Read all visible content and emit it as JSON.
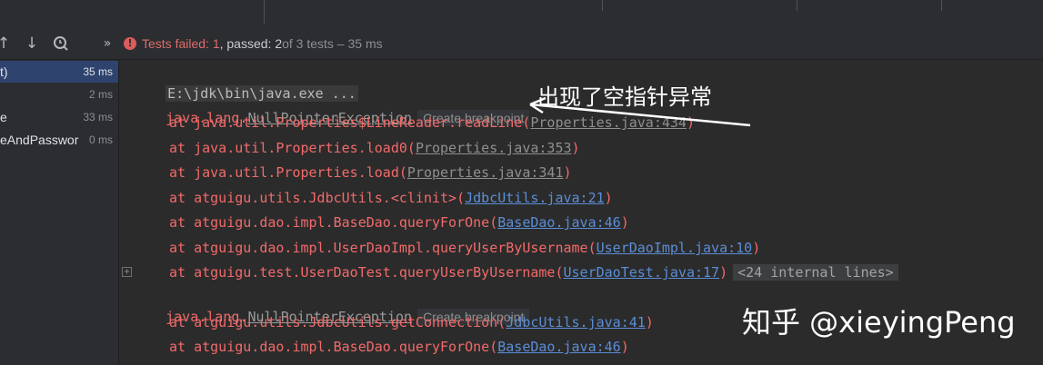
{
  "toolbar": {
    "icons": [
      "arrow-up-icon",
      "arrow-down-icon",
      "clock-search-icon",
      "double-chevron-right-icon"
    ],
    "status_failed": "Tests failed: 1",
    "status_passed": ", passed: 2",
    "status_total": " of 3 tests – 35 ms"
  },
  "sidebar": {
    "items": [
      {
        "label": "t)",
        "time": "35 ms",
        "selected": true
      },
      {
        "label": "",
        "time": "2 ms"
      },
      {
        "label": "e",
        "time": "33 ms"
      },
      {
        "label": "eAndPasswor",
        "time": "0 ms"
      }
    ]
  },
  "console": {
    "cmd": "E:\\jdk\\bin\\java.exe ...",
    "exc1_prefix": "java.lang.",
    "exc1_name": "NullPointerException",
    "bp_label": "Create breakpoint",
    "frames1": [
      {
        "text": "at java.util.Properties$LineReader.readLine(",
        "link": "Properties.java:434",
        "blue": false
      },
      {
        "text": "at java.util.Properties.load0(",
        "link": "Properties.java:353",
        "blue": false
      },
      {
        "text": "at java.util.Properties.load(",
        "link": "Properties.java:341",
        "blue": false
      },
      {
        "text": "at atguigu.utils.JdbcUtils.<clinit>(",
        "link": "JdbcUtils.java:21",
        "blue": true
      },
      {
        "text": "at atguigu.dao.impl.BaseDao.queryForOne(",
        "link": "BaseDao.java:46",
        "blue": true
      },
      {
        "text": "at atguigu.dao.impl.UserDaoImpl.queryUserByUsername(",
        "link": "UserDaoImpl.java:10",
        "blue": true
      },
      {
        "text": "at atguigu.test.UserDaoTest.queryUserByUsername(",
        "link": "UserDaoTest.java:17",
        "blue": true
      }
    ],
    "internal_lines": "<24 internal lines>",
    "exc2_prefix": "java.lang.",
    "exc2_name": "NullPointerException",
    "frames2": [
      {
        "text": "at atguigu.utils.JdbcUtils.getConnection(",
        "link": "JdbcUtils.java:41",
        "blue": true
      },
      {
        "text": "at atguigu.dao.impl.BaseDao.queryForOne(",
        "link": "BaseDao.java:46",
        "blue": true
      }
    ],
    "close_paren": ")"
  },
  "annotation": "出现了空指针异常",
  "watermark": "知乎 @xieyingPeng",
  "colors": {
    "error": "#f26a6a",
    "link": "#5b8dd6",
    "selection": "#2e436e"
  }
}
